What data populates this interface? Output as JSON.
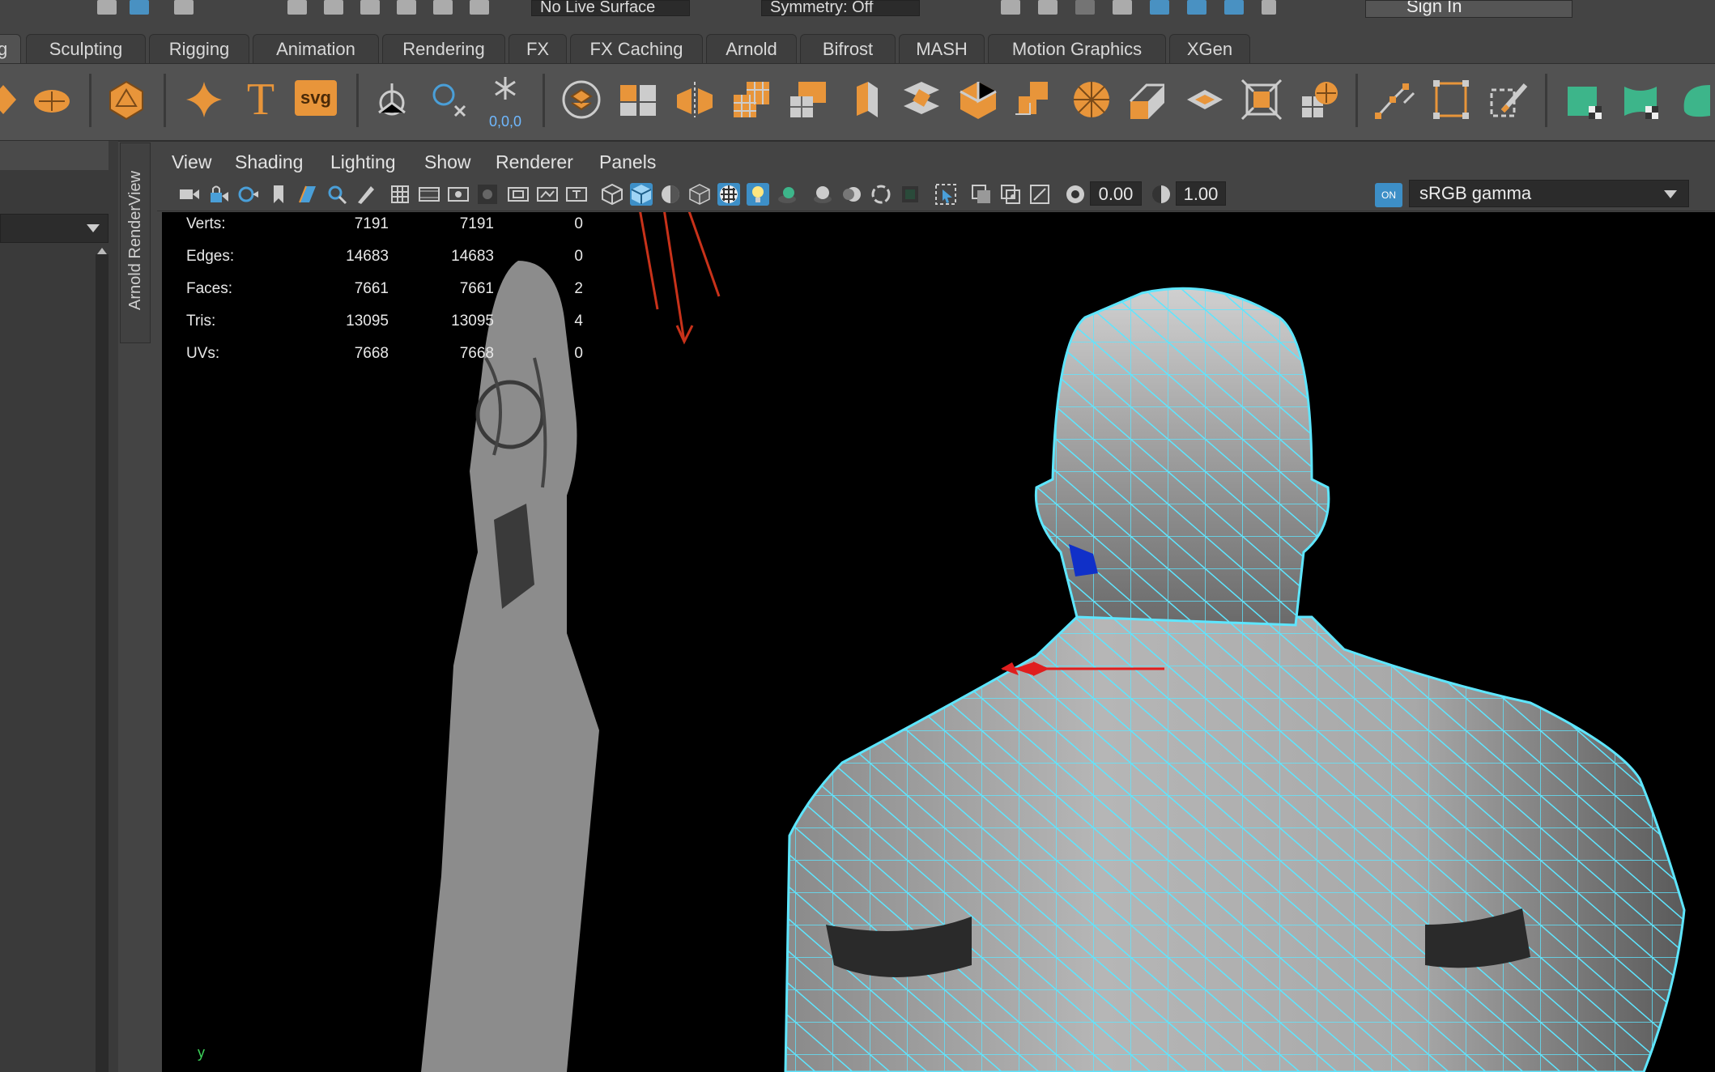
{
  "statusline": {
    "live_surface": "No Live Surface",
    "symmetry": "Symmetry: Off",
    "sign_in": "Sign In"
  },
  "shelf_tabs": [
    {
      "label": "g",
      "active": true
    },
    {
      "label": "Sculpting"
    },
    {
      "label": "Rigging"
    },
    {
      "label": "Animation"
    },
    {
      "label": "Rendering"
    },
    {
      "label": "FX"
    },
    {
      "label": "FX Caching"
    },
    {
      "label": "Arnold"
    },
    {
      "label": "Bifrost"
    },
    {
      "label": "MASH"
    },
    {
      "label": "Motion Graphics"
    },
    {
      "label": "XGen"
    }
  ],
  "shelf": {
    "text_icon": "T",
    "svg_icon": "svg",
    "coord_label": "0,0,0"
  },
  "side_tab": {
    "label": "Arnold RenderView"
  },
  "panel_menu": [
    "View",
    "Shading",
    "Lighting",
    "Show",
    "Renderer",
    "Panels"
  ],
  "panel_toolbar": {
    "exposure": "0.00",
    "gamma": "1.00",
    "color_mgmt_badge": "ON",
    "color_space": "sRGB gamma"
  },
  "hud": {
    "rows": [
      {
        "label": "Verts:",
        "a": "7191",
        "b": "7191",
        "c": "0"
      },
      {
        "label": "Edges:",
        "a": "14683",
        "b": "14683",
        "c": "0"
      },
      {
        "label": "Faces:",
        "a": "7661",
        "b": "7661",
        "c": "2"
      },
      {
        "label": "Tris:",
        "a": "13095",
        "b": "13095",
        "c": "4"
      },
      {
        "label": "UVs:",
        "a": "7668",
        "b": "7668",
        "c": "0"
      }
    ]
  },
  "axis_label": "y",
  "colors": {
    "accent_orange": "#e8953a",
    "selection_blue": "#3d8fc7",
    "wireframe_cyan": "#5ee6ff",
    "shelf_green": "#3db58a"
  }
}
